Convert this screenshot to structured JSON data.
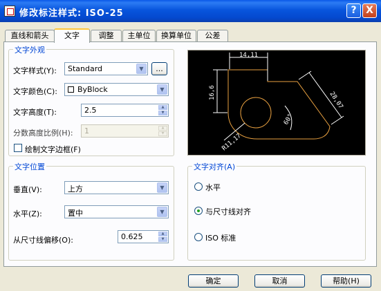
{
  "window": {
    "title": "修改标注样式: ISO-25",
    "help_glyph": "?",
    "close_glyph": "X"
  },
  "tabs": [
    {
      "label": "直线和箭头",
      "active": false
    },
    {
      "label": "文字",
      "active": true
    },
    {
      "label": "调整",
      "active": false
    },
    {
      "label": "主单位",
      "active": false
    },
    {
      "label": "换算单位",
      "active": false
    },
    {
      "label": "公差",
      "active": false
    }
  ],
  "text_appearance": {
    "title": "文字外观",
    "style_label": "文字样式(Y):",
    "style_value": "Standard",
    "browse_label": "...",
    "color_label": "文字颜色(C):",
    "color_value": "ByBlock",
    "height_label": "文字高度(T):",
    "height_value": "2.5",
    "fraction_label": "分数高度比例(H):",
    "fraction_value": "1",
    "frame_label": "绘制文字边框(F)",
    "frame_checked": false
  },
  "text_placement": {
    "title": "文字位置",
    "vertical_label": "垂直(V):",
    "vertical_value": "上方",
    "horizontal_label": "水平(Z):",
    "horizontal_value": "置中",
    "offset_label": "从尺寸线偏移(O):",
    "offset_value": "0.625"
  },
  "text_alignment": {
    "title": "文字对齐(A)",
    "options": [
      "水平",
      "与尺寸线对齐",
      "ISO 标准"
    ],
    "selected": 1
  },
  "preview": {
    "dims": [
      "14,11",
      "16,6",
      "28,07",
      "60°",
      "R11,17"
    ],
    "colors": {
      "background": "#000000",
      "dimension": "#FFFFFF",
      "geometry": "#E8A040"
    }
  },
  "buttons": {
    "ok": "确定",
    "cancel": "取消",
    "help": "帮助(H)"
  }
}
